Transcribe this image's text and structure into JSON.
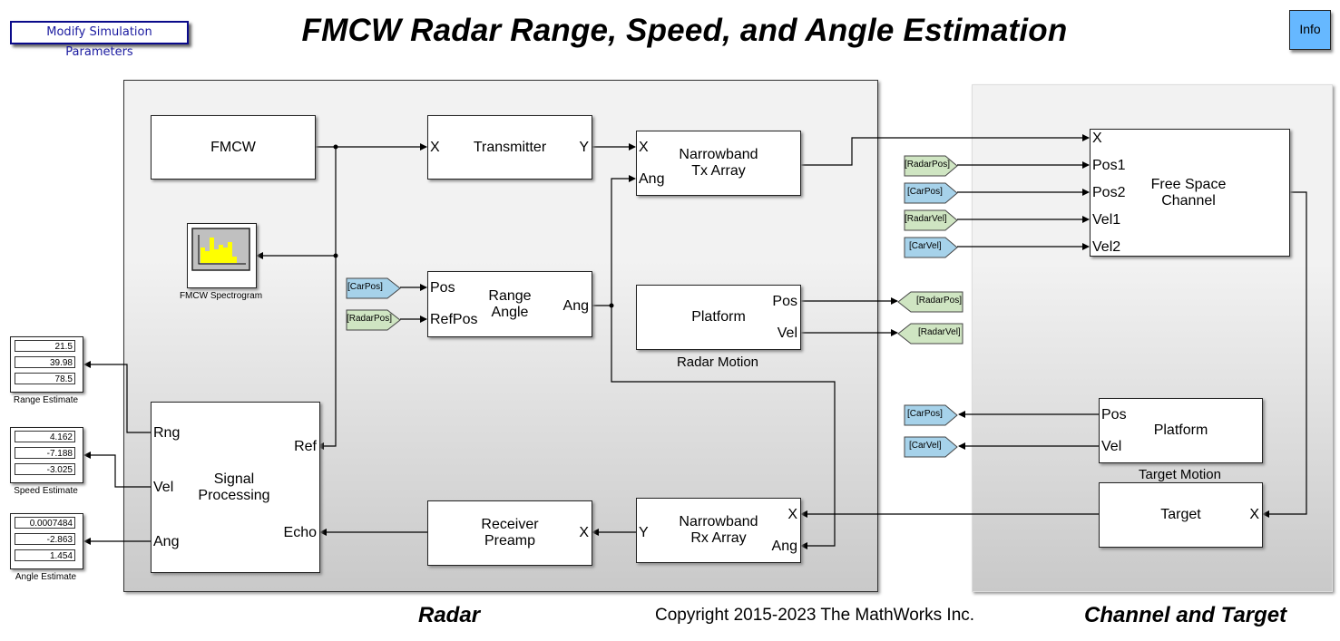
{
  "title": "FMCW Radar Range, Speed, and Angle Estimation",
  "buttons": {
    "modify": "Modify Simulation Parameters",
    "info": "Info"
  },
  "blocks": {
    "fmcw": {
      "label": "FMCW"
    },
    "transmitter": {
      "label": "Transmitter",
      "in": "X",
      "out": "Y"
    },
    "tx_array": {
      "label": "Narrowband\nTx Array",
      "in1": "X",
      "in2": "Ang"
    },
    "spectrogram": {
      "caption": "FMCW Spectrogram"
    },
    "range_angle": {
      "label": "Range\nAngle",
      "in1": "Pos",
      "in2": "RefPos",
      "out": "Ang"
    },
    "radar_platform": {
      "label": "Platform",
      "out1": "Pos",
      "out2": "Vel",
      "caption": "Radar Motion"
    },
    "signal_processing": {
      "label": "Signal\nProcessing",
      "out1": "Rng",
      "out2": "Vel",
      "out3": "Ang",
      "in1": "Ref",
      "in2": "Echo"
    },
    "receiver_preamp": {
      "label": "Receiver\nPreamp",
      "in": "X"
    },
    "rx_array": {
      "label": "Narrowband\nRx Array",
      "out": "Y",
      "in1": "X",
      "in2": "Ang"
    },
    "free_space": {
      "label": "Free Space\nChannel",
      "in": [
        "X",
        "Pos1",
        "Pos2",
        "Vel1",
        "Vel2"
      ]
    },
    "target_platform": {
      "label": "Platform",
      "out1": "Pos",
      "out2": "Vel",
      "caption": "Target Motion"
    },
    "target": {
      "label": "Target",
      "in": "X"
    }
  },
  "tags": {
    "car_pos": "[CarPos]",
    "radar_pos": "[RadarPos]",
    "car_vel": "[CarVel]",
    "radar_vel": "[RadarVel]"
  },
  "colors": {
    "car_tag": "#a6d2ea",
    "radar_tag": "#cfe5c2",
    "info_button": "#66b8ff"
  },
  "displays": {
    "range": {
      "caption": "Range Estimate",
      "values": [
        "21.5",
        "39.98",
        "78.5"
      ]
    },
    "speed": {
      "caption": "Speed Estimate",
      "values": [
        "4.162",
        "-7.188",
        "-3.025"
      ]
    },
    "angle": {
      "caption": "Angle Estimate",
      "values": [
        "0.0007484",
        "-2.863",
        "1.454"
      ]
    }
  },
  "sections": {
    "radar": "Radar",
    "channel": "Channel and Target"
  },
  "copyright": "Copyright 2015-2023 The MathWorks Inc."
}
